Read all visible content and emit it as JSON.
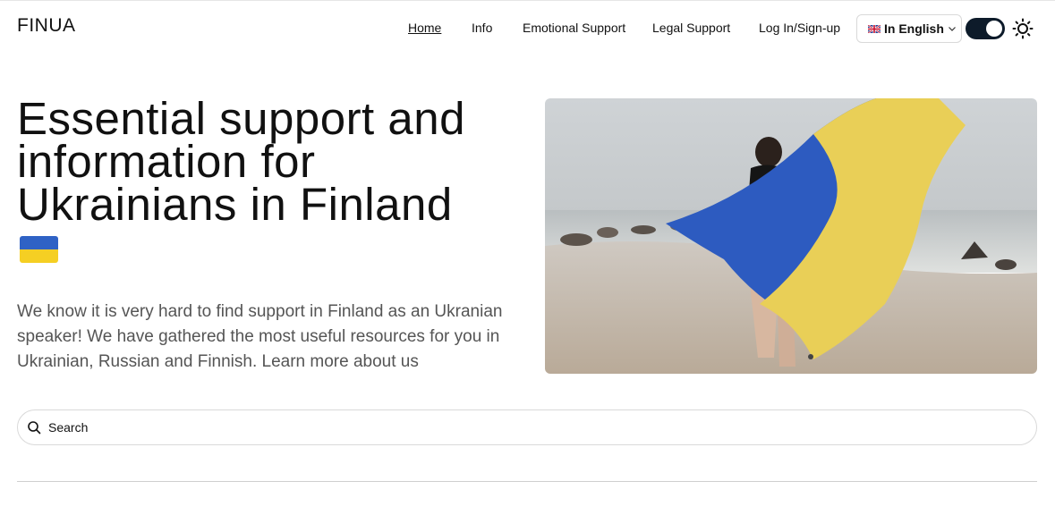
{
  "header": {
    "logo": "FINUA",
    "nav": {
      "home": "Home",
      "info": "Info",
      "emotional": "Emotional Support",
      "legal": "Legal Support",
      "login": "Log In/Sign-up"
    },
    "language": {
      "selected": "In English",
      "flag_icon": "uk-flag-icon"
    },
    "theme_toggle": {
      "state": "dark-on"
    }
  },
  "hero": {
    "title": "Essential support and information for Ukrainians in Finland",
    "flag_icon": "ukraine-flag-icon",
    "description": "We know it is very hard to find support in Finland as an Ukranian speaker! We have gathered the most useful resources for you in Ukrainian, Russian and Finnish. Learn more about us",
    "image_subject": "person holding Ukrainian flag on beach"
  },
  "search": {
    "placeholder": "Search"
  },
  "colors": {
    "accent_dark": "#0d1b2a",
    "ua_blue": "#2f62c5",
    "ua_yellow": "#f5cf23",
    "border": "#d9d9d9"
  }
}
